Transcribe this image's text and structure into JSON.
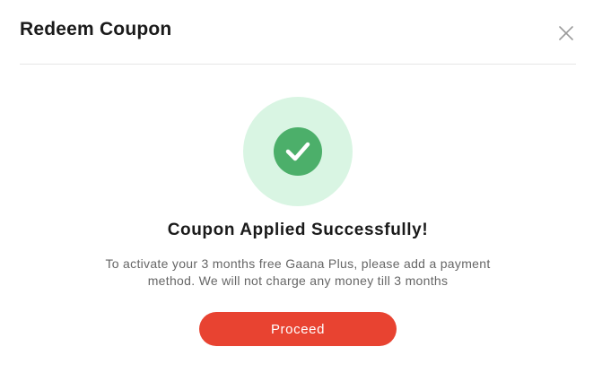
{
  "dialog": {
    "title": "Redeem Coupon",
    "close_icon": "close-icon"
  },
  "success": {
    "icon": "checkmark-icon",
    "circle_color": "#d9f5e3",
    "badge_color": "#4caf6a",
    "heading": "Coupon Applied Successfully!",
    "message": "To activate your 3 months free Gaana Plus, please add a payment method. We will not charge any money till 3 months"
  },
  "actions": {
    "proceed_label": "Proceed",
    "proceed_color": "#e84331"
  }
}
